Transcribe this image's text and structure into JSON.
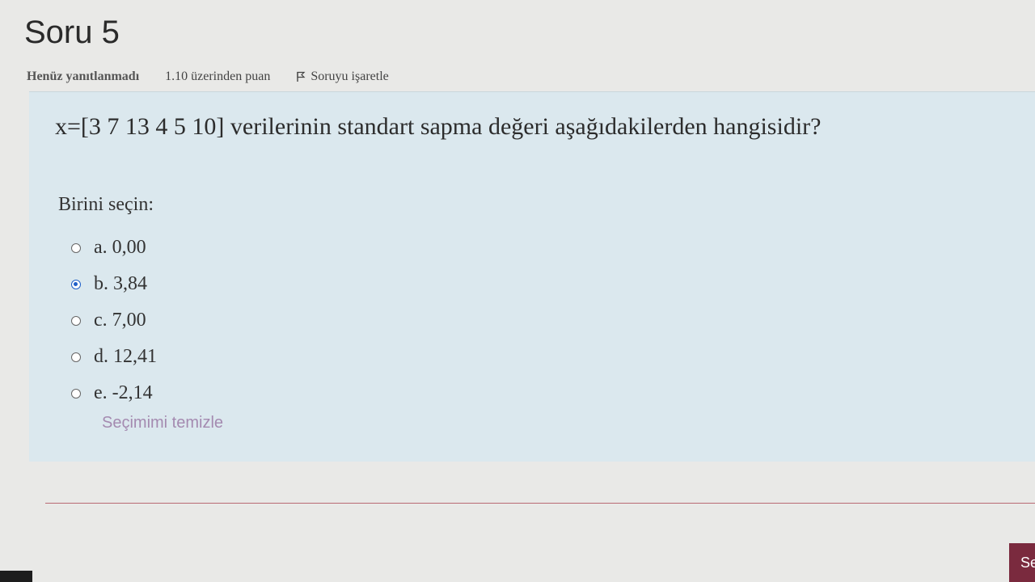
{
  "question": {
    "title": "Soru 5",
    "state": "Henüz yanıtlanmadı",
    "grade": "1.10 üzerinden puan",
    "flag_label": "Soruyu işaretle",
    "text": "x=[3 7 13 4 5 10] verilerinin standart sapma değeri aşağıdakilerden hangisidir?",
    "prompt": "Birini seçin:",
    "answers": [
      {
        "label": "a. 0,00",
        "selected": false
      },
      {
        "label": "b. 3,84",
        "selected": true
      },
      {
        "label": "c. 7,00",
        "selected": false
      },
      {
        "label": "d. 12,41",
        "selected": false
      },
      {
        "label": "e. -2,14",
        "selected": false
      }
    ],
    "clear_choice": "Seçimimi temizle"
  },
  "nav": {
    "next_label": "Se"
  },
  "colors": {
    "accent": "#7a2a3e",
    "question_bg": "#dbe8ee",
    "radio_selected": "#1f5fc8"
  },
  "icons": {
    "flag": "flag-icon"
  }
}
